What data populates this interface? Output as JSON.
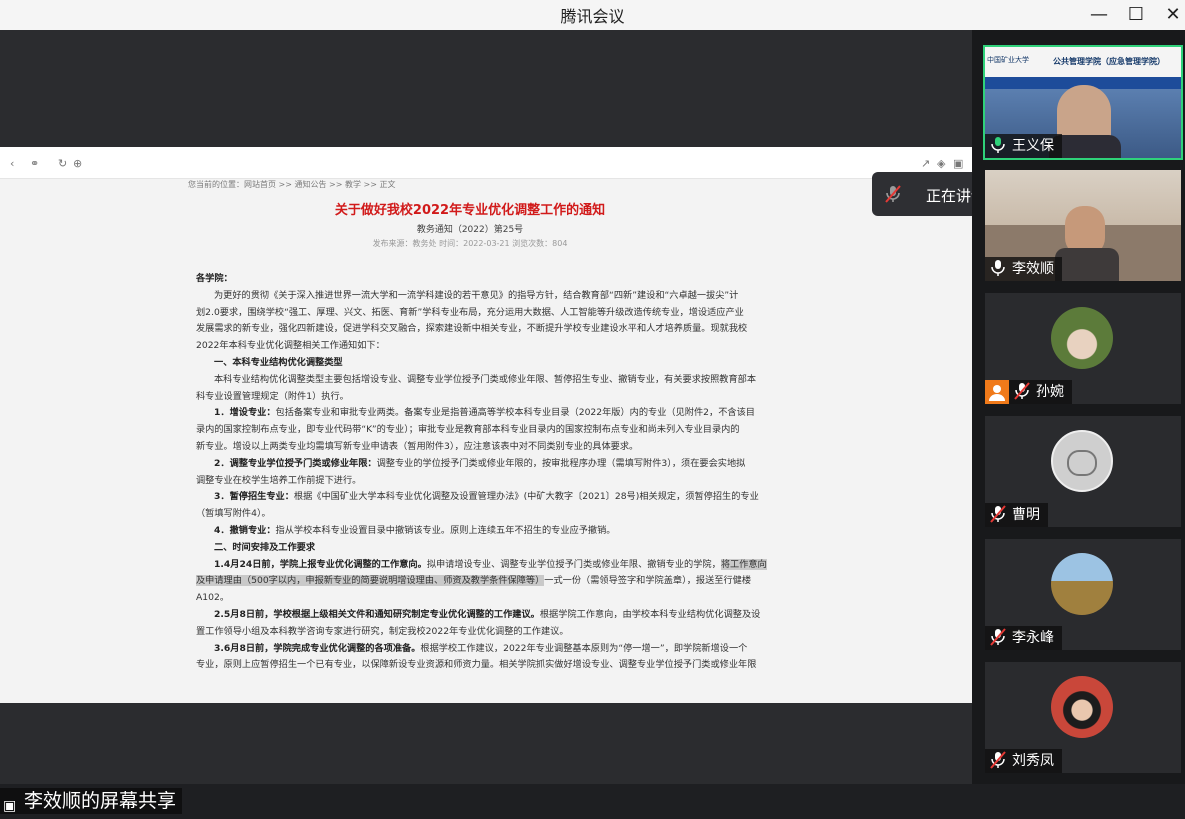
{
  "app": {
    "title": "腾讯会议"
  },
  "window_controls": {
    "minimize": "—",
    "maximize": "☐",
    "close": "✕"
  },
  "shared_doc": {
    "breadcrumb": "您当前的位置：网站首页 >> 通知公告 >> 教学 >> 正文",
    "title": "关于做好我校2022年专业优化调整工作的通知",
    "subtitle": "教务通知（2022）第25号",
    "meta": "发布来源：教务处    时间：2022-03-21    浏览次数：804",
    "p1": "各学院：",
    "p2a": "为更好的贯彻《关于深入推进世界一流大学和一流学科建设的若干意见》的指导方针，结合教育部“四新”建设和“六卓越一拔尖”计",
    "p2b": "划2.0要求，围绕学校“强工、厚理、兴文、拓医、育新”学科专业布局，充分运用大数据、人工智能等升级改造传统专业，增设适应产业",
    "p2c": "发展需求的新专业，强化四新建设，促进学科交叉融合，探索建设新中相关专业，不断提升学校专业建设水平和人才培养质量。现就我校",
    "p2d": "2022年本科专业优化调整相关工作通知如下：",
    "h1": "一、本科专业结构优化调整类型",
    "p3a": "本科专业结构优化调整类型主要包括增设专业、调整专业学位授予门类或修业年限、暂停招生专业、撤销专业，有关要求按照教育部本",
    "p3b": "科专业设置管理规定（附件1）执行。",
    "p4a_b": "1．增设专业：",
    "p4a": "包括备案专业和审批专业两类。备案专业是指普通高等学校本科专业目录（2022年版）内的专业（见附件2，不含该目",
    "p4b": "录内的国家控制布点专业，即专业代码带“K”的专业）；审批专业是教育部本科专业目录内的国家控制布点专业和尚未列入专业目录内的",
    "p4c": "新专业。增设以上两类专业均需填写新专业申请表（暂用附件3），应注意该表中对不同类别专业的具体要求。",
    "p5a_b": "2．调整专业学位授予门类或修业年限：",
    "p5a": "调整专业的学位授予门类或修业年限的，按审批程序办理（需填写附件3），须在要会实地拟",
    "p5b": "调整专业在校学生培养工作前提下进行。",
    "p6a_b": "3．暂停招生专业：",
    "p6a": "根据《中国矿业大学本科专业优化调整及设置管理办法》(中矿大教字〔2021〕28号)相关规定，须暂停招生的专业",
    "p6b": "（暂填写附件4）。",
    "p7_b": "4．撤销专业：",
    "p7": "指从学校本科专业设置目录中撤销该专业。原则上连续五年不招生的专业应予撤销。",
    "h2": "二、时间安排及工作要求",
    "p8a_b": "1.4月24日前，学院上报专业优化调整的工作意向。",
    "p8a": "拟申请增设专业、调整专业学位授予门类或修业年限、撤销专业的学院，",
    "p8a_hl": "将工作意向",
    "p8b_hl1": "及申请理由（500字以内，申报新专业的简要说明增设理由、师资及教学条件保障等）",
    "p8b": "一式一份（需领导签字和学院盖章），报送至行健楼",
    "p8c": "A102。",
    "p9a_b": "2.5月8日前，学校根据上级相关文件和通知研究制定专业优化调整的工作建议。",
    "p9a": "根据学院工作意向，由学校本科专业结构优化调整及设",
    "p9b": "置工作领导小组及本科教学咨询专家进行研究，制定我校2022年专业优化调整的工作建议。",
    "p10a_b": "3.6月8日前，学院完成专业优化调整的各项准备。",
    "p10a": "根据学校工作建议，2022年专业调整基本原则为“停一增一”，即学院新增设一个",
    "p10b": "专业，原则上应暂停招生一个已有专业，以保障新设专业资源和师资力量。相关学院抓实做好增设专业、调整专业学位授予门类或修业年限"
  },
  "speaking": {
    "label": "正在讲话: 王义保;"
  },
  "share_label": "李效顺的屏幕共享",
  "participants": [
    {
      "name": "王义保",
      "muted": false,
      "active": true
    },
    {
      "name": "李效顺",
      "muted": false,
      "active": false
    },
    {
      "name": "孙婉",
      "muted": true,
      "active": false
    },
    {
      "name": "曹明",
      "muted": true,
      "active": false
    },
    {
      "name": "李永峰",
      "muted": true,
      "active": false
    },
    {
      "name": "刘秀凤",
      "muted": true,
      "active": false
    }
  ],
  "banner": {
    "school": "公共管理学院（应急管理学院）",
    "uni": "中国矿业大学"
  },
  "colors": {
    "active_border": "#2fd27a",
    "title_red": "#d11a1a",
    "muted_red": "#e53935",
    "badge_orange": "#f07a1a"
  },
  "icons": {
    "mic": "mic-icon",
    "mic_muted": "mic-muted-icon",
    "user": "user-icon",
    "back": "back-icon"
  }
}
